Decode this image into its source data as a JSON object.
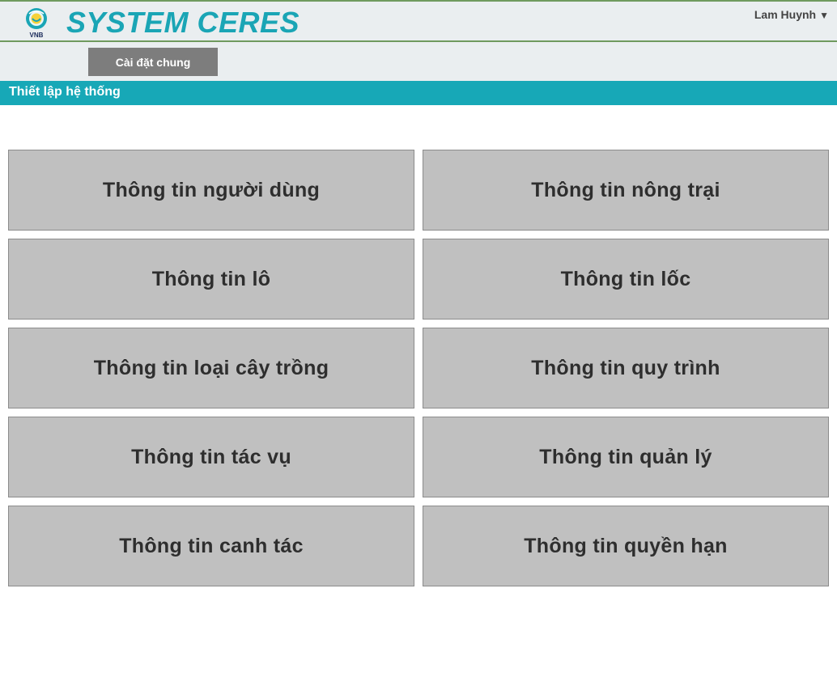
{
  "header": {
    "logo_text": "VNB",
    "app_title": "SYSTEM CERES",
    "user_name": "Lam Huynh",
    "user_caret": "▼"
  },
  "navbar": {
    "general_settings_label": "Cài đặt chung"
  },
  "section": {
    "title": "Thiết lập hệ thống"
  },
  "tiles": [
    {
      "label": "Thông tin người dùng"
    },
    {
      "label": "Thông tin nông trại"
    },
    {
      "label": "Thông tin lô"
    },
    {
      "label": "Thông tin lốc"
    },
    {
      "label": "Thông tin loại cây trồng"
    },
    {
      "label": "Thông tin quy trình"
    },
    {
      "label": "Thông tin tác vụ"
    },
    {
      "label": "Thông tin quản lý"
    },
    {
      "label": "Thông tin canh tác"
    },
    {
      "label": "Thông tin quyền hạn"
    }
  ],
  "colors": {
    "brand": "#1aa5b5",
    "section_bar": "#17a8b7",
    "tile_bg": "#c0c0c0",
    "nav_button_bg": "#7d7d7d"
  }
}
